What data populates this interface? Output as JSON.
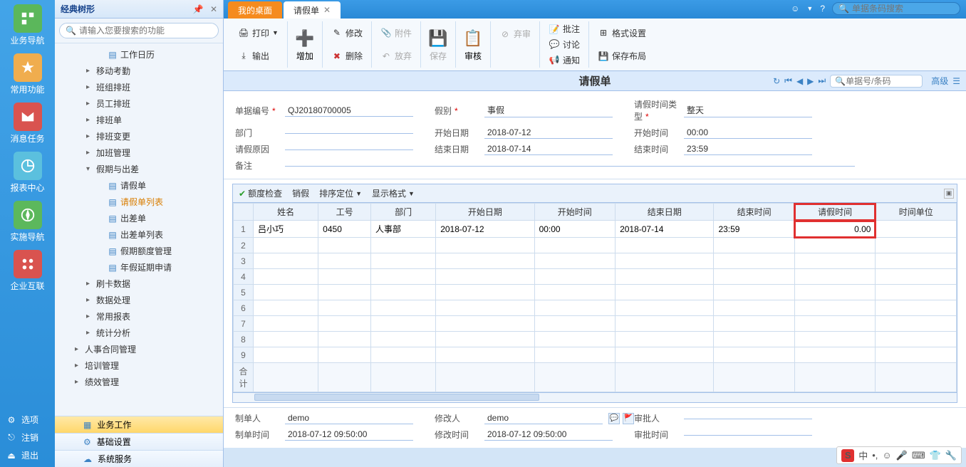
{
  "left_rail": {
    "items": [
      {
        "label": "业务导航",
        "color": "#5bb75b"
      },
      {
        "label": "常用功能",
        "color": "#f0ad4e"
      },
      {
        "label": "消息任务",
        "color": "#d9534f"
      },
      {
        "label": "报表中心",
        "color": "#5bc0de"
      },
      {
        "label": "实施导航",
        "color": "#5cb85c"
      },
      {
        "label": "企业互联",
        "color": "#d9534f"
      }
    ],
    "bottom": [
      {
        "label": "选项"
      },
      {
        "label": "注销"
      },
      {
        "label": "退出"
      }
    ]
  },
  "tree": {
    "title": "经典树形",
    "search_placeholder": "请输入您要搜索的功能",
    "nodes": [
      {
        "label": "工作日历",
        "level": 3,
        "leaf": true
      },
      {
        "label": "移动考勤",
        "level": 2,
        "exp": "▸"
      },
      {
        "label": "班组排班",
        "level": 2,
        "exp": "▸"
      },
      {
        "label": "员工排班",
        "level": 2,
        "exp": "▸"
      },
      {
        "label": "排班单",
        "level": 2,
        "exp": "▸"
      },
      {
        "label": "排班变更",
        "level": 2,
        "exp": "▸"
      },
      {
        "label": "加班管理",
        "level": 2,
        "exp": "▸"
      },
      {
        "label": "假期与出差",
        "level": 2,
        "exp": "▾"
      },
      {
        "label": "请假单",
        "level": 3,
        "leaf": true
      },
      {
        "label": "请假单列表",
        "level": 3,
        "leaf": true,
        "highlight": true
      },
      {
        "label": "出差单",
        "level": 3,
        "leaf": true
      },
      {
        "label": "出差单列表",
        "level": 3,
        "leaf": true
      },
      {
        "label": "假期额度管理",
        "level": 3,
        "leaf": true
      },
      {
        "label": "年假延期申请",
        "level": 3,
        "leaf": true
      },
      {
        "label": "刷卡数据",
        "level": 2,
        "exp": "▸"
      },
      {
        "label": "数据处理",
        "level": 2,
        "exp": "▸"
      },
      {
        "label": "常用报表",
        "level": 2,
        "exp": "▸"
      },
      {
        "label": "统计分析",
        "level": 2,
        "exp": "▸"
      },
      {
        "label": "人事合同管理",
        "level": 1,
        "exp": "▸"
      },
      {
        "label": "培训管理",
        "level": 1,
        "exp": "▸"
      },
      {
        "label": "绩效管理",
        "level": 1,
        "exp": "▸"
      }
    ],
    "footer_tabs": [
      "业务工作",
      "基础设置",
      "系统服务"
    ]
  },
  "tabs": {
    "home": "我的桌面",
    "active": "请假单"
  },
  "topbar_search_placeholder": "单据条码搜索",
  "ribbon": {
    "print": "打印",
    "output": "输出",
    "add": "增加",
    "modify": "修改",
    "delete": "删除",
    "attach": "附件",
    "abandon": "放弃",
    "save": "保存",
    "audit": "审核",
    "reject": "弃审",
    "annotate": "批注",
    "discuss": "讨论",
    "notify": "通知",
    "format": "格式设置",
    "savelayout": "保存布局"
  },
  "doc": {
    "title": "请假单",
    "nav_search_placeholder": "单据号/条码",
    "advanced": "高级",
    "fields": {
      "bill_no_label": "单据编号",
      "bill_no": "QJ20180700005",
      "leave_type_label": "假别",
      "leave_type": "事假",
      "time_type_label": "请假时间类型",
      "time_type": "整天",
      "dept_label": "部门",
      "dept": "",
      "start_date_label": "开始日期",
      "start_date": "2018-07-12",
      "start_time_label": "开始时间",
      "start_time": "00:00",
      "reason_label": "请假原因",
      "reason": "",
      "end_date_label": "结束日期",
      "end_date": "2018-07-14",
      "end_time_label": "结束时间",
      "end_time": "23:59",
      "remark_label": "备注",
      "remark": ""
    }
  },
  "grid": {
    "toolbar": [
      "额度检查",
      "销假",
      "排序定位",
      "显示格式"
    ],
    "columns": [
      "姓名",
      "工号",
      "部门",
      "开始日期",
      "开始时间",
      "结束日期",
      "结束时间",
      "请假时间",
      "时间单位"
    ],
    "rows": [
      {
        "name": "吕小巧",
        "emp_no": "0450",
        "dept": "人事部",
        "start_date": "2018-07-12",
        "start_time": "00:00",
        "end_date": "2018-07-14",
        "end_time": "23:59",
        "duration": "0.00",
        "unit": ""
      }
    ],
    "sum_label": "合计"
  },
  "footer": {
    "creator_label": "制单人",
    "creator": "demo",
    "modifier_label": "修改人",
    "modifier": "demo",
    "approver_label": "审批人",
    "approver": "",
    "create_time_label": "制单时间",
    "create_time": "2018-07-12 09:50:00",
    "modify_time_label": "修改时间",
    "modify_time": "2018-07-12 09:50:00",
    "approve_time_label": "审批时间",
    "approve_time": ""
  },
  "ime": {
    "mode": "中"
  }
}
